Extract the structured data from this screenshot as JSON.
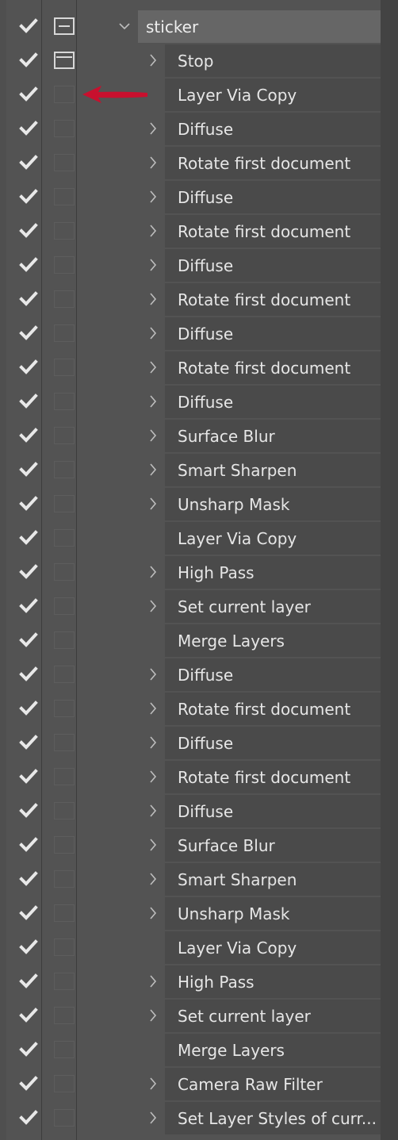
{
  "actions_panel": {
    "set_name": "sticker",
    "items": [
      {
        "label": "Stop",
        "expandable": true,
        "dialog_toggle": true
      },
      {
        "label": "Layer Via Copy",
        "expandable": false,
        "dialog_toggle": false,
        "annotated": true
      },
      {
        "label": "Diffuse",
        "expandable": true,
        "dialog_toggle": false
      },
      {
        "label": "Rotate first document",
        "expandable": true,
        "dialog_toggle": false
      },
      {
        "label": "Diffuse",
        "expandable": true,
        "dialog_toggle": false
      },
      {
        "label": "Rotate first document",
        "expandable": true,
        "dialog_toggle": false
      },
      {
        "label": "Diffuse",
        "expandable": true,
        "dialog_toggle": false
      },
      {
        "label": "Rotate first document",
        "expandable": true,
        "dialog_toggle": false
      },
      {
        "label": "Diffuse",
        "expandable": true,
        "dialog_toggle": false
      },
      {
        "label": "Rotate first document",
        "expandable": true,
        "dialog_toggle": false
      },
      {
        "label": "Diffuse",
        "expandable": true,
        "dialog_toggle": false
      },
      {
        "label": "Surface Blur",
        "expandable": true,
        "dialog_toggle": false
      },
      {
        "label": "Smart Sharpen",
        "expandable": true,
        "dialog_toggle": false
      },
      {
        "label": "Unsharp Mask",
        "expandable": true,
        "dialog_toggle": false
      },
      {
        "label": "Layer Via Copy",
        "expandable": false,
        "dialog_toggle": false
      },
      {
        "label": "High Pass",
        "expandable": true,
        "dialog_toggle": false
      },
      {
        "label": "Set current layer",
        "expandable": true,
        "dialog_toggle": false
      },
      {
        "label": "Merge Layers",
        "expandable": false,
        "dialog_toggle": false
      },
      {
        "label": "Diffuse",
        "expandable": true,
        "dialog_toggle": false
      },
      {
        "label": "Rotate first document",
        "expandable": true,
        "dialog_toggle": false
      },
      {
        "label": "Diffuse",
        "expandable": true,
        "dialog_toggle": false
      },
      {
        "label": "Rotate first document",
        "expandable": true,
        "dialog_toggle": false
      },
      {
        "label": "Diffuse",
        "expandable": true,
        "dialog_toggle": false
      },
      {
        "label": "Surface Blur",
        "expandable": true,
        "dialog_toggle": false
      },
      {
        "label": "Smart Sharpen",
        "expandable": true,
        "dialog_toggle": false
      },
      {
        "label": "Unsharp Mask",
        "expandable": true,
        "dialog_toggle": false
      },
      {
        "label": "Layer Via Copy",
        "expandable": false,
        "dialog_toggle": false
      },
      {
        "label": "High Pass",
        "expandable": true,
        "dialog_toggle": false
      },
      {
        "label": "Set current layer",
        "expandable": true,
        "dialog_toggle": false
      },
      {
        "label": "Merge Layers",
        "expandable": false,
        "dialog_toggle": false
      },
      {
        "label": "Camera Raw Filter",
        "expandable": true,
        "dialog_toggle": false
      },
      {
        "label": "Set Layer Styles of curr...",
        "expandable": true,
        "dialog_toggle": false
      }
    ]
  },
  "icons": {
    "check": "checkmark-icon",
    "dialog": "dialog-toggle-icon",
    "expand_closed": "chevron-right-icon",
    "expand_open": "chevron-down-icon",
    "annotation": "red-arrow-annotation"
  },
  "colors": {
    "panel_bg": "#535353",
    "label_bg": "#4a4a4a",
    "set_label_bg": "#666666",
    "text": "#e6e6e6",
    "check": "#e8e8e8",
    "annotation_arrow": "#c8102e"
  }
}
